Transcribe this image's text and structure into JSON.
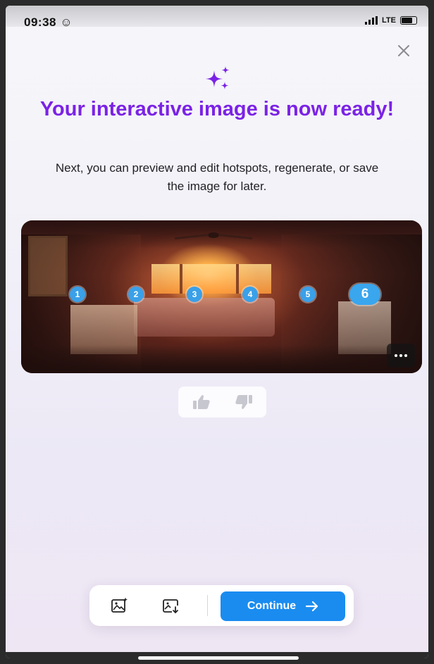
{
  "status_bar": {
    "time": "09:38 ☺",
    "network": "LTE"
  },
  "header": {
    "close_icon": "close-icon",
    "sparkle_icon": "sparkles-icon",
    "title": "Your interactive image is now ready!",
    "subtitle": "Next, you can preview and edit hotspots, regenerate, or save the image for later."
  },
  "image_card": {
    "hotspots": [
      "1",
      "2",
      "3",
      "4",
      "5",
      "6"
    ],
    "more_icon": "more-horizontal-icon"
  },
  "feedback": {
    "like_icon": "thumbs-up-icon",
    "dislike_icon": "thumbs-down-icon"
  },
  "toolbar": {
    "regenerate_icon": "image-sparkle-icon",
    "save_icon": "image-download-icon",
    "continue_label": "Continue",
    "continue_icon": "arrow-right-icon"
  },
  "colors": {
    "accent_purple": "#7b22e6",
    "primary_blue": "#1a8cf0",
    "hotspot_blue": "#3aa0e8"
  }
}
